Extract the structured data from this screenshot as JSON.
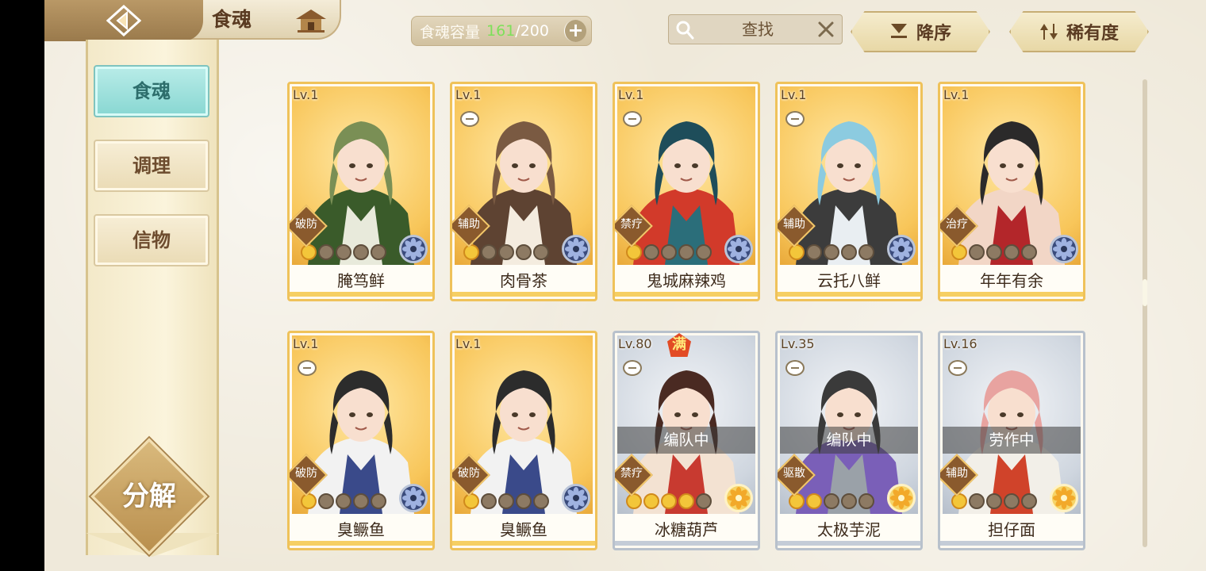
{
  "header": {
    "title": "食魂",
    "capacity_label": "食魂容量",
    "capacity_current": "161",
    "capacity_separator": "/",
    "capacity_max": "200",
    "capacity_add": "+",
    "search_placeholder": "查找",
    "sort_order_label": "降序",
    "sort_field_label": "稀有度"
  },
  "sidebar": {
    "tabs": [
      {
        "label": "食魂",
        "active": true
      },
      {
        "label": "调理",
        "active": false
      },
      {
        "label": "信物",
        "active": false
      }
    ],
    "decompose_label": "分解"
  },
  "cards": [
    {
      "level": "Lv.1",
      "name": "腌笃鲜",
      "role": "破防",
      "stars_on": 1,
      "frame": "gold",
      "element": "blue",
      "status": "",
      "full": false,
      "locked": false,
      "palette": [
        "#7a8f55",
        "#e8eadb",
        "#3a5b2a"
      ]
    },
    {
      "level": "Lv.1",
      "name": "肉骨茶",
      "role": "辅助",
      "stars_on": 1,
      "frame": "gold",
      "element": "blue",
      "status": "",
      "full": false,
      "locked": true,
      "palette": [
        "#7a5a42",
        "#f4ecdf",
        "#5e4332"
      ]
    },
    {
      "level": "Lv.1",
      "name": "鬼城麻辣鸡",
      "role": "禁疗",
      "stars_on": 1,
      "frame": "gold",
      "element": "blue",
      "status": "",
      "full": false,
      "locked": true,
      "palette": [
        "#1e4d5a",
        "#2b6e7a",
        "#d23a2a"
      ]
    },
    {
      "level": "Lv.1",
      "name": "云托八鲜",
      "role": "辅助",
      "stars_on": 1,
      "frame": "gold",
      "element": "blue",
      "status": "",
      "full": false,
      "locked": true,
      "palette": [
        "#8ccbe0",
        "#e9eef2",
        "#3c3c3c"
      ]
    },
    {
      "level": "Lv.1",
      "name": "年年有余",
      "role": "治疗",
      "stars_on": 1,
      "frame": "gold",
      "element": "blue",
      "status": "",
      "full": false,
      "locked": false,
      "palette": [
        "#2b2a2a",
        "#b3262a",
        "#f2d6c6"
      ]
    },
    {
      "level": "Lv.1",
      "name": "臭鳜鱼",
      "role": "破防",
      "stars_on": 1,
      "frame": "gold",
      "element": "blue",
      "status": "",
      "full": false,
      "locked": true,
      "palette": [
        "#2c2c2c",
        "#3a4a8a",
        "#f2f2f2"
      ]
    },
    {
      "level": "Lv.1",
      "name": "臭鳜鱼",
      "role": "破防",
      "stars_on": 1,
      "frame": "gold",
      "element": "blue",
      "status": "",
      "full": false,
      "locked": false,
      "palette": [
        "#2c2c2c",
        "#3a4a8a",
        "#f2f2f2"
      ]
    },
    {
      "level": "Lv.80",
      "name": "冰糖葫芦",
      "role": "禁疗",
      "stars_on": 4,
      "frame": "silver",
      "element": "gold",
      "status": "编队中",
      "full": true,
      "locked": true,
      "palette": [
        "#4a2a22",
        "#c83a30",
        "#f3e2d2"
      ]
    },
    {
      "level": "Lv.35",
      "name": "太极芋泥",
      "role": "驱散",
      "stars_on": 2,
      "frame": "silver",
      "element": "gold",
      "status": "编队中",
      "full": false,
      "locked": true,
      "palette": [
        "#3a3a3a",
        "#9aa1a8",
        "#7a5fb8"
      ]
    },
    {
      "level": "Lv.16",
      "name": "担仔面",
      "role": "辅助",
      "stars_on": 1,
      "frame": "silver",
      "element": "gold",
      "status": "劳作中",
      "full": false,
      "locked": true,
      "palette": [
        "#e8a3a0",
        "#d0432a",
        "#f2efe8"
      ]
    }
  ],
  "colors": {
    "accent_teal": "#88d7d2",
    "gold_frame": "#efc25a",
    "silver_frame": "#b8c1cc",
    "capacity_green": "#7ee05a"
  },
  "icons": [
    "back-arrow-icon",
    "pavilion-icon",
    "search-icon",
    "close-icon",
    "sort-down-icon",
    "sort-swap-icon",
    "flower-element-icon",
    "lock-icon"
  ]
}
